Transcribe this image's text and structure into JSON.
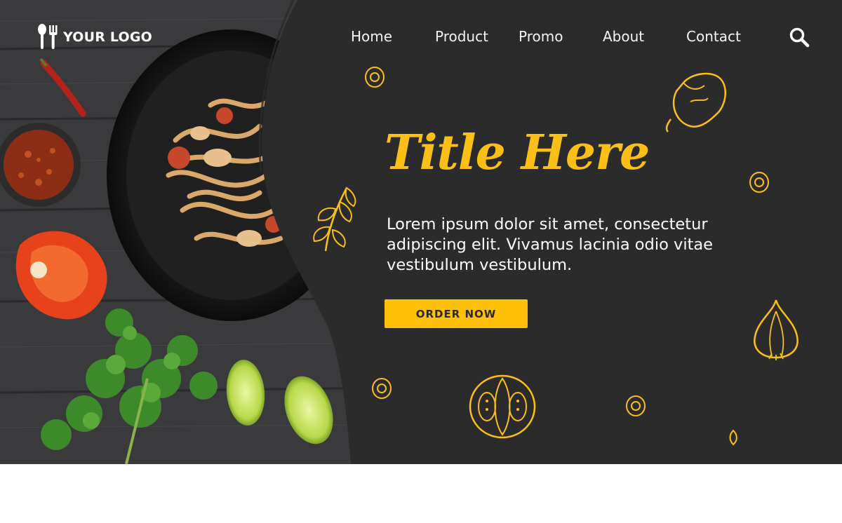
{
  "nav": {
    "logo_text": "YOUR LOGO",
    "links": [
      "Home",
      "Product",
      "Promo",
      "About",
      "Contact"
    ]
  },
  "hero": {
    "title": "Title Here",
    "description": "Lorem ipsum dolor sit amet, consectetur adipiscing elit. Vivamus lacinia odio vitae vestibulum vestibulum.",
    "button_label": "ORDER NOW"
  },
  "colors": {
    "accent": "#fbbf16",
    "background": "#2b2b2b",
    "text": "#ffffff"
  },
  "icons": [
    "spoon-fork-icon",
    "search-icon",
    "pepper-doodle-icon",
    "parsley-doodle-icon",
    "onion-doodle-icon",
    "tomato-doodle-icon",
    "seed-doodle-icon"
  ]
}
